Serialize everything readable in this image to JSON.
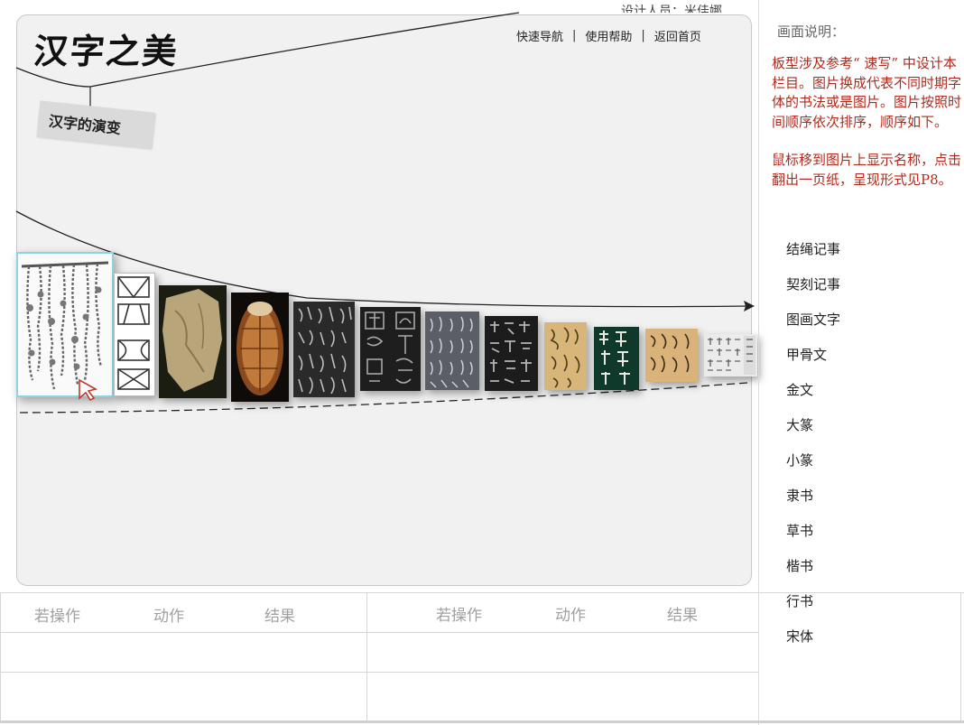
{
  "header": {
    "designer": "设计人员：米佳娜",
    "logo": "汉字之美",
    "nav": [
      "快速导航",
      "使用帮助",
      "返回首页"
    ],
    "section_tag": "汉字的演变"
  },
  "timeline": {
    "selected_index": 0,
    "items": [
      "结绳记事",
      "契刻记事",
      "图画文字",
      "甲骨文",
      "金文",
      "大篆",
      "小篆",
      "隶书",
      "草书",
      "楷书",
      "行书",
      "宋体"
    ]
  },
  "panel": {
    "title": "画面说明：",
    "desc1": "板型涉及参考“ 速写” 中设计本栏目。图片换成代表不同时期字体的书法或是图片。图片按照时间顺序依次排序，顺序如下。",
    "desc2": "鼠标移到图片上显示名称，点击翻出一页纸，呈现形式见P8。"
  },
  "spec_table": {
    "headers": [
      "若操作",
      "动作",
      "结果",
      "若操作",
      "动作",
      "结果"
    ]
  },
  "colors": {
    "accent_red": "#b02a1c",
    "frame_bg": "#f1f1f1",
    "selection": "#8fd3e3"
  }
}
